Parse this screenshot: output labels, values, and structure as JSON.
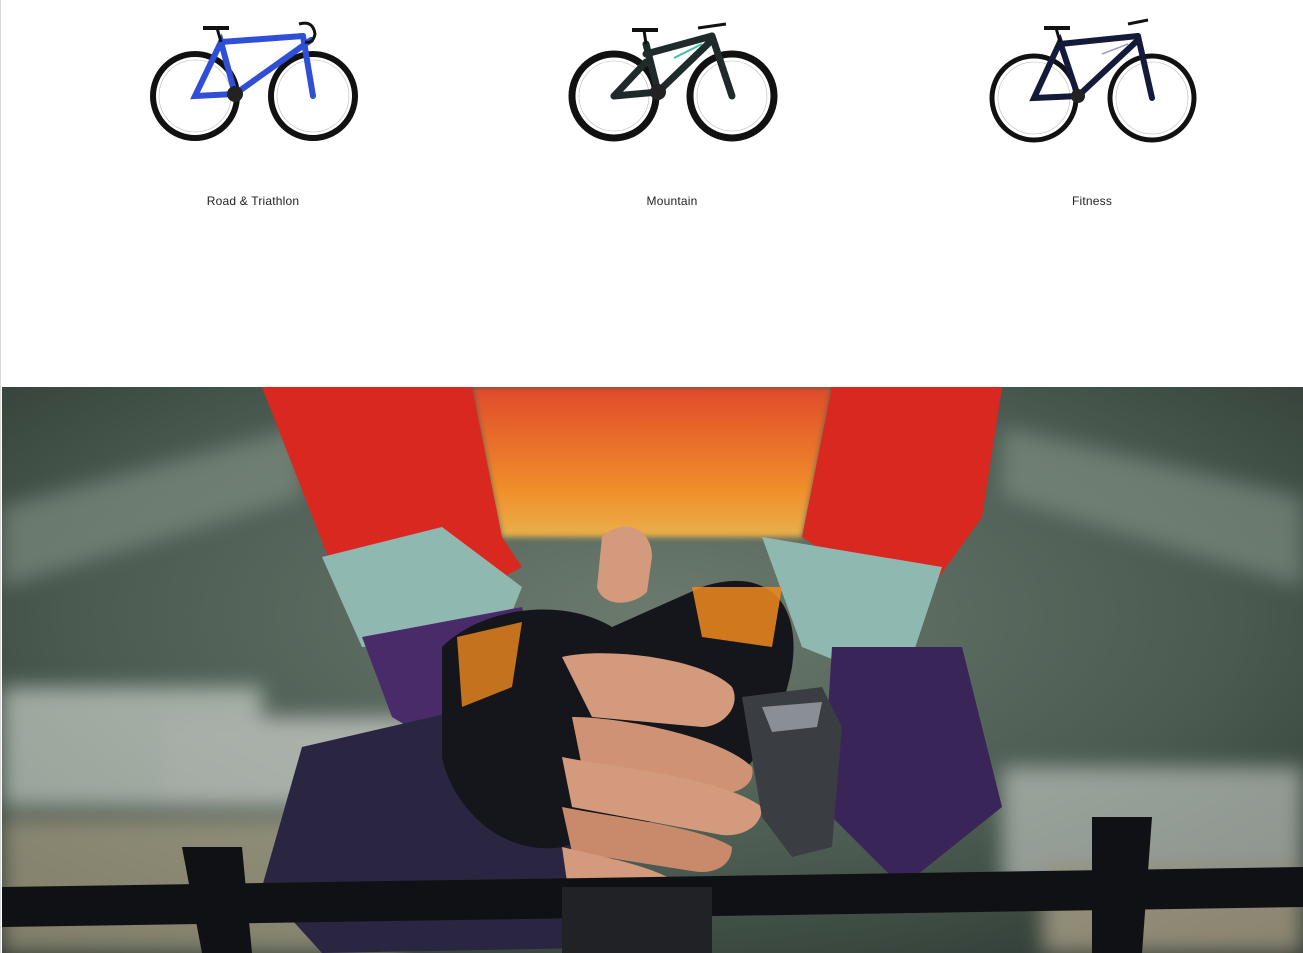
{
  "categories": [
    {
      "label": "Road & Triathlon",
      "icon": "road-bike-icon",
      "frame_color": "#2e4fd6"
    },
    {
      "label": "Mountain",
      "icon": "mountain-bike-icon",
      "frame_color": "#1f2a2a"
    },
    {
      "label": "Fitness",
      "icon": "fitness-bike-icon",
      "frame_color": "#141a3a"
    }
  ],
  "hero": {
    "icon": "cyclist-clasped-hands-photo",
    "colors": {
      "jersey": "#d92b22",
      "cuff": "#8fb8b0",
      "glove": "#15161c",
      "skin": "#d39a7d",
      "background": "#46564d"
    }
  }
}
